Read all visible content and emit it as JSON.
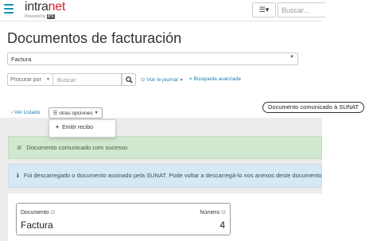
{
  "topbar": {
    "logo_text_main": "intra",
    "logo_text_accent": "net",
    "logo_sub": "Powered by",
    "logo_sub_badge": "iPS",
    "view_toggle": "☰▾",
    "search_placeholder": "Buscar..."
  },
  "page": {
    "title": "Documentos de facturación",
    "doc_type_value": "Factura"
  },
  "search": {
    "field_selector": "Procurar por",
    "placeholder": "Buscar",
    "journal_link": "Voir le journal",
    "advanced_link": "Búsqueda avanzada"
  },
  "status_badge": "Documento comunicado à SUNAT",
  "toolbar": {
    "back_link": "Ver Listado",
    "more_options": "otras opciones"
  },
  "dropdown": {
    "items": [
      {
        "label": "Emitir recibo"
      }
    ]
  },
  "alerts": {
    "success": "Documento comunicado com sucesso",
    "info": "Foi descarregado o documento assinado pela SUNAT. Pode voltar a descarregá-lo nos anexos deste documento."
  },
  "card": {
    "documento_label": "Documento",
    "documento_value": "Factura",
    "numero_label": "Número",
    "numero_value": "4"
  },
  "colors": {
    "accent_blue": "#1a7fb4",
    "logo_red": "#d2232a",
    "success_bg": "#d2e7cf",
    "info_bg": "#d6e8f4"
  }
}
